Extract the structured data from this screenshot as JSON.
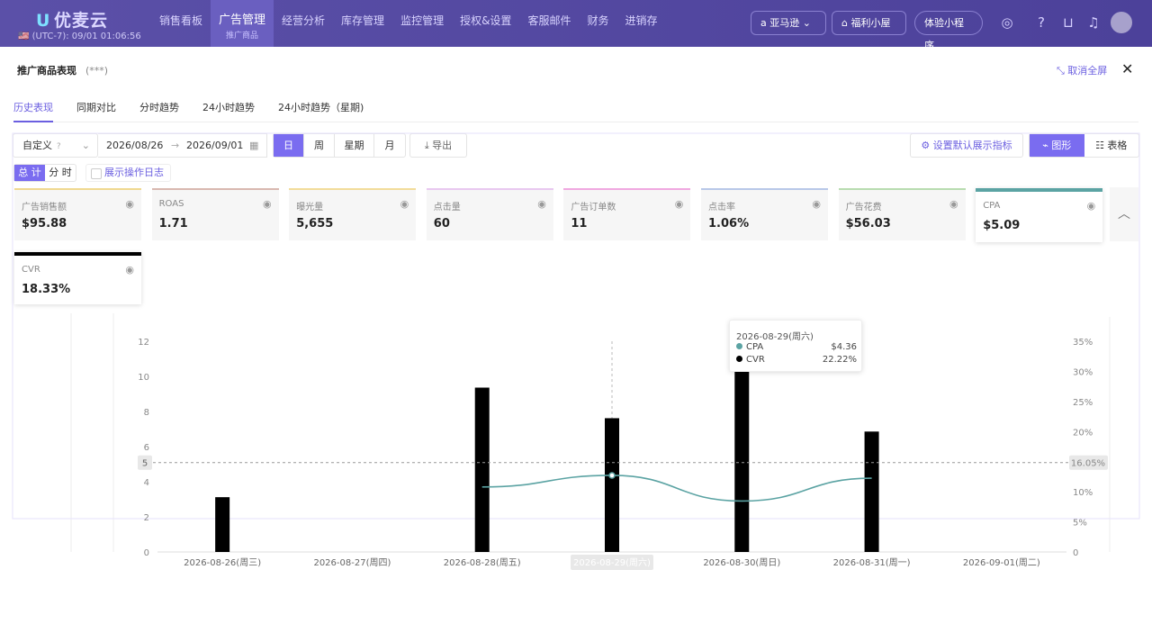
{
  "app": {
    "logo": "优麦云",
    "timezone": "🇺🇸 (UTC-7): 09/01 01:06:56"
  },
  "nav": [
    {
      "label": "销售看板"
    },
    {
      "label": "广告管理",
      "sub": "推广商品",
      "active": true
    },
    {
      "label": "经营分析"
    },
    {
      "label": "库存管理"
    },
    {
      "label": "监控管理"
    },
    {
      "label": "授权&设置"
    },
    {
      "label": "客服邮件"
    },
    {
      "label": "财务"
    },
    {
      "label": "进销存"
    }
  ],
  "topright": {
    "marketplace": "亚马逊",
    "welfare": "福利小屋",
    "miniprogram": "体验小程序"
  },
  "modal": {
    "title": "推广商品表现",
    "title_mask": "(***)",
    "fullscreen_label": "取消全屏",
    "tabs": [
      "历史表现",
      "同期对比",
      "分时趋势",
      "24小时趋势",
      "24小时趋势（星期)"
    ],
    "active_tab": 0,
    "toolbar": {
      "range_select": "自定义",
      "start_date": "2026/08/26",
      "end_date": "2026/09/01",
      "granularity": [
        "日",
        "周",
        "星期",
        "月"
      ],
      "granularity_active": 0,
      "export_label": "导出",
      "set_default_label": "设置默认展示指标",
      "view_chart_label": "图形",
      "view_table_label": "表格"
    },
    "total_label": "总 计",
    "hourly_label": "分 时",
    "log_label": "展示操作日志",
    "metrics": [
      {
        "label": "广告销售额",
        "value": "$95.88",
        "color": "#f0d890"
      },
      {
        "label": "ROAS",
        "value": "1.71",
        "color": "#d8b8b0"
      },
      {
        "label": "曝光量",
        "value": "5,655",
        "color": "#f2dc9a"
      },
      {
        "label": "点击量",
        "value": "60",
        "color": "#e8c8f0"
      },
      {
        "label": "广告订单数",
        "value": "11",
        "color": "#f0a8e0"
      },
      {
        "label": "点击率",
        "value": "1.06%",
        "color": "#b8c8e8"
      },
      {
        "label": "广告花费",
        "value": "$56.03",
        "color": "#b8dcb0"
      },
      {
        "label": "CPA",
        "value": "$5.09",
        "color": "#5ba3a3",
        "selected": true
      },
      {
        "label": "CVR",
        "value": "18.33%",
        "color": "#000000",
        "selected": true
      }
    ]
  },
  "chart_data": {
    "type": "bar",
    "categories": [
      "2026-08-26(周三)",
      "2026-08-27(周四)",
      "2026-08-28(周五)",
      "2026-08-29(周六)",
      "2026-08-30(周日)",
      "2026-08-31(周一)",
      "2026-09-01(周二)"
    ],
    "series": [
      {
        "name": "CVR",
        "type": "bar",
        "axis": "right",
        "color": "#000000",
        "values": [
          9.1,
          null,
          27.3,
          22.22,
          30.4,
          20.0,
          null
        ]
      },
      {
        "name": "CPA",
        "type": "line",
        "axis": "left",
        "color": "#5ba3a3",
        "values": [
          null,
          null,
          3.7,
          4.36,
          2.9,
          4.2,
          null
        ]
      }
    ],
    "left_axis": {
      "ylim": [
        0,
        12
      ],
      "ticks": [
        "0",
        "2",
        "4",
        "6",
        "8",
        "10",
        "12"
      ]
    },
    "right_axis": {
      "ylim": [
        0,
        35
      ],
      "ticks": [
        "0",
        "5%",
        "10%",
        "15%",
        "20%",
        "25%",
        "30%",
        "35%"
      ]
    },
    "reference_left_label": "5",
    "reference_right_label": "16.05%",
    "reference_left_value": 5.09,
    "hover_category": "2026-08-29(周六)",
    "tooltip": {
      "title": "2026-08-29(周六)",
      "rows": [
        {
          "name": "CPA",
          "value": "$4.36",
          "color": "#5ba3a3"
        },
        {
          "name": "CVR",
          "value": "22.22%",
          "color": "#000000"
        }
      ]
    }
  }
}
